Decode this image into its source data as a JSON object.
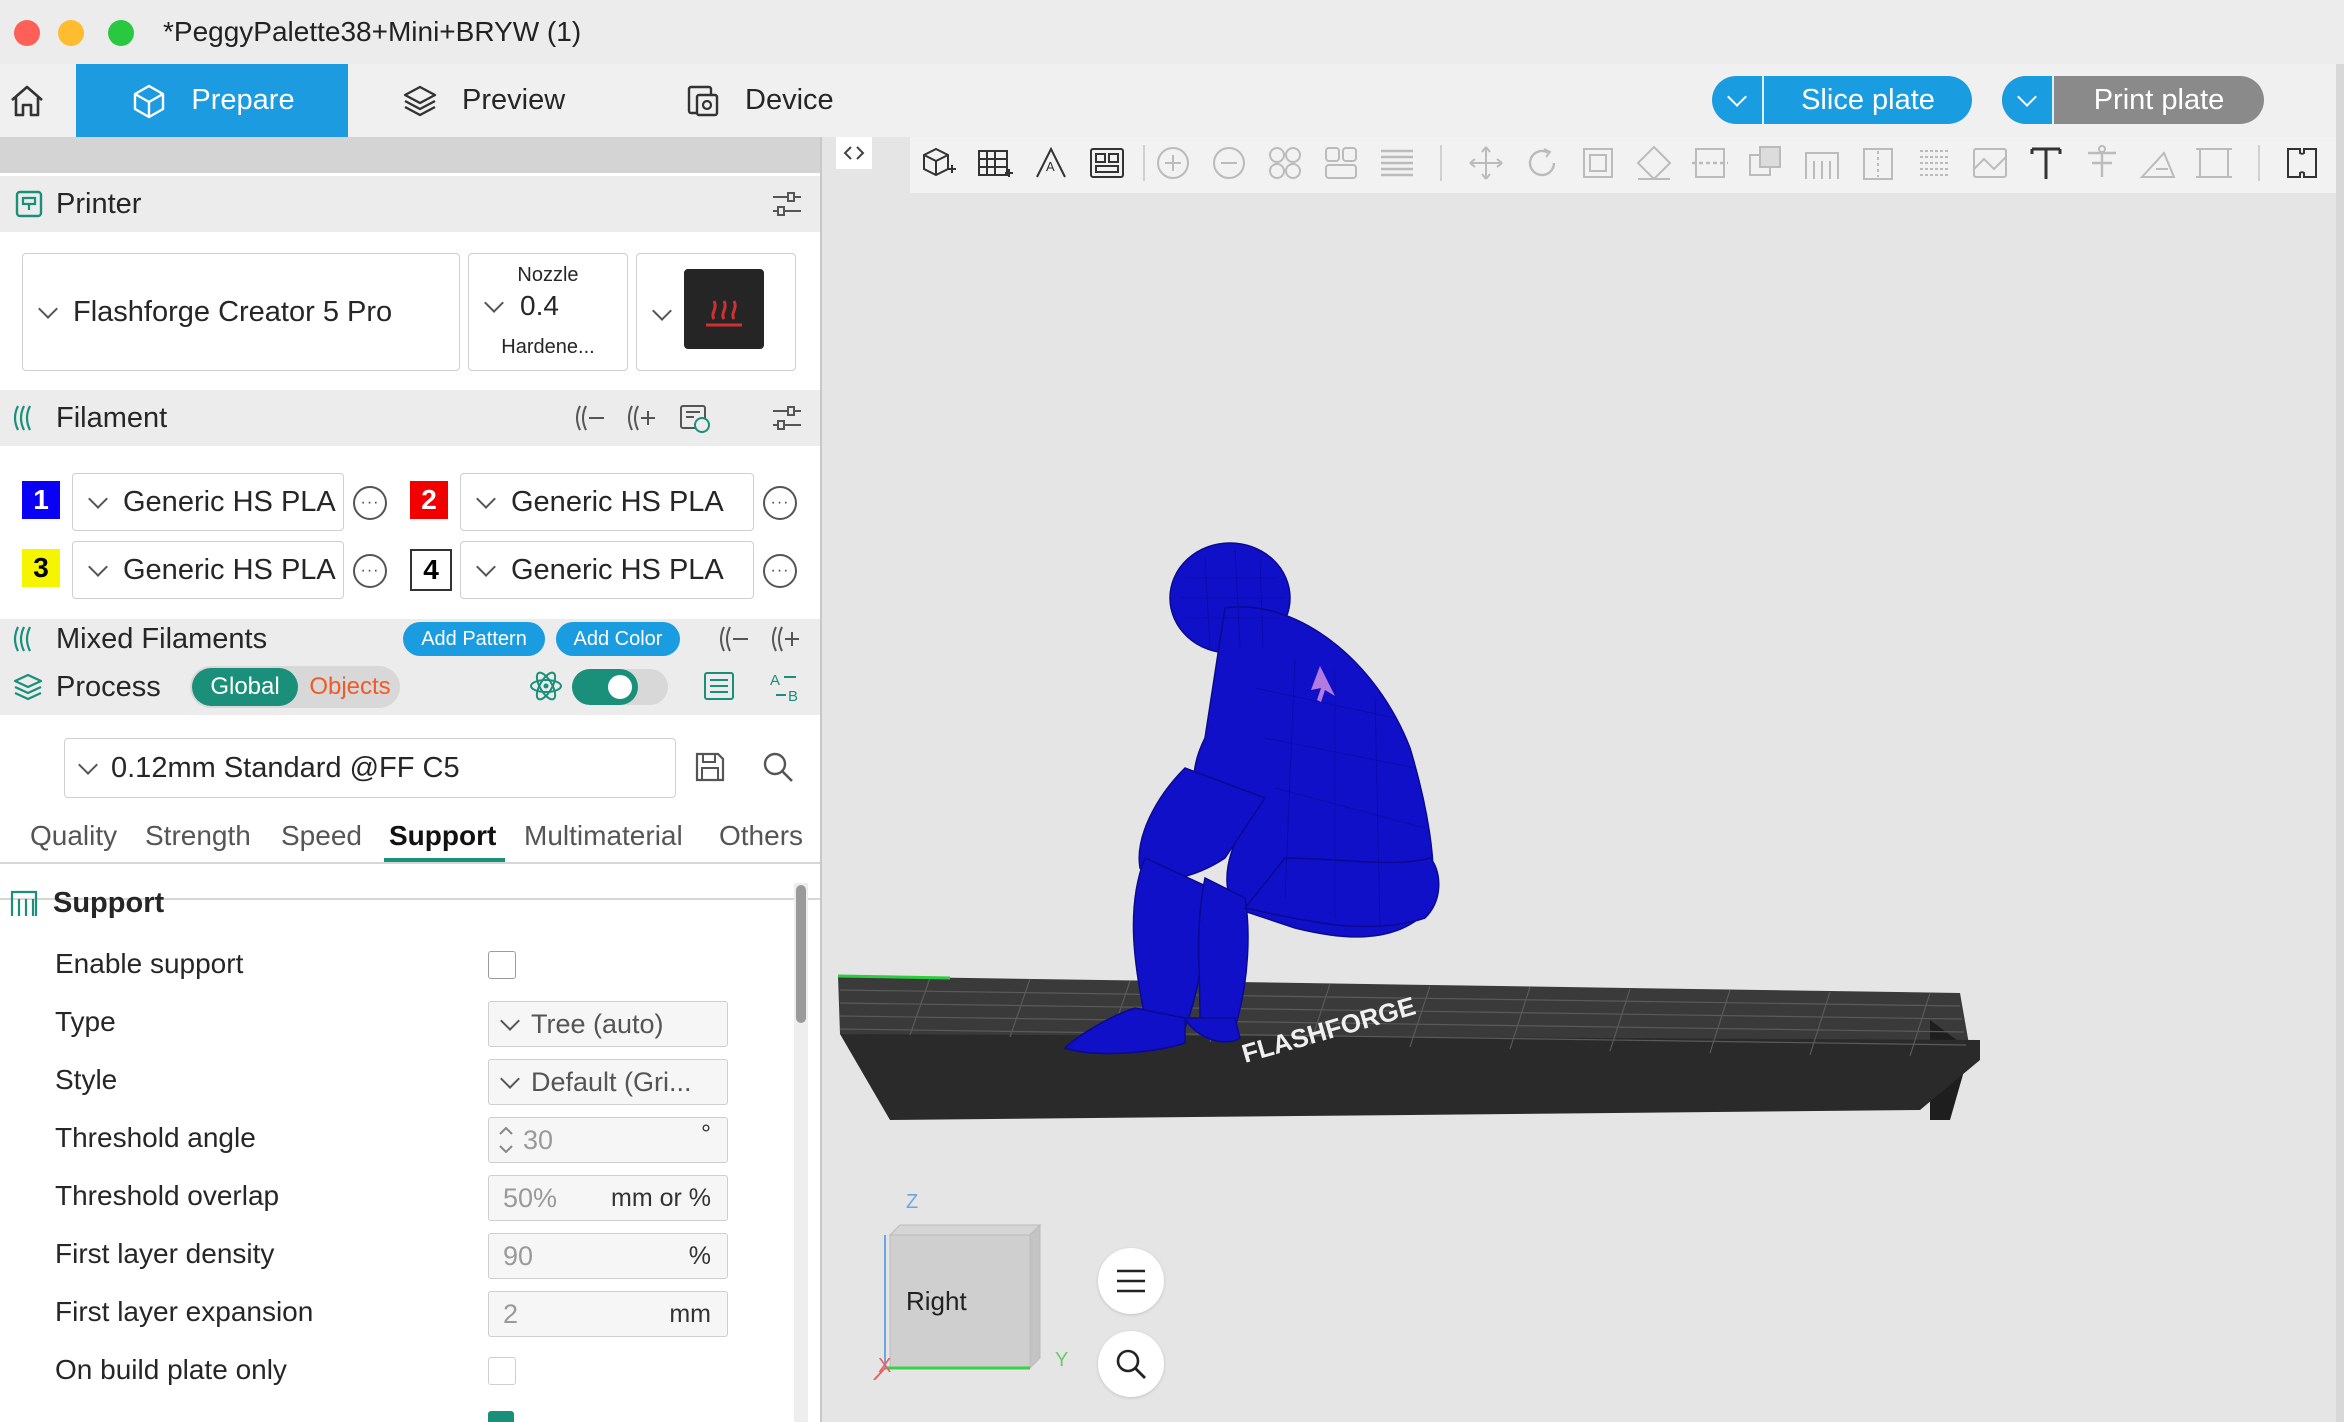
{
  "window": {
    "title": "*PeggyPalette38+Mini+BRYW (1)"
  },
  "nav": {
    "tabs": [
      {
        "label": "Prepare",
        "active": true
      },
      {
        "label": "Preview",
        "active": false
      },
      {
        "label": "Device",
        "active": false
      }
    ],
    "slice_label": "Slice plate",
    "print_label": "Print plate",
    "accent": "#1a9de0",
    "active_tab_color": "#1c9be0"
  },
  "printer": {
    "section_title": "Printer",
    "name": "Flashforge Creator 5 Pro",
    "nozzle_label": "Nozzle",
    "nozzle_value": "0.4",
    "nozzle_type": "Hardene..."
  },
  "filament": {
    "section_title": "Filament",
    "slots": [
      {
        "number": "1",
        "color": "#0a00f5",
        "text_color": "#ffffff",
        "name": "Generic HS PLA"
      },
      {
        "number": "2",
        "color": "#f20000",
        "text_color": "#ffffff",
        "name": "Generic HS PLA"
      },
      {
        "number": "3",
        "color": "#f5f500",
        "text_color": "#000000",
        "name": "Generic HS PLA"
      },
      {
        "number": "4",
        "color": "#ffffff",
        "text_color": "#000000",
        "name": "Generic HS PLA"
      }
    ],
    "mixed_title": "Mixed Filaments",
    "add_pattern": "Add Pattern",
    "add_color": "Add Color"
  },
  "process": {
    "section_title": "Process",
    "toggle_global": "Global",
    "toggle_objects": "Objects",
    "preset": "0.12mm Standard @FF C5",
    "tabs": [
      "Quality",
      "Strength",
      "Speed",
      "Support",
      "Multimaterial",
      "Others"
    ],
    "active_tab": "Support"
  },
  "support": {
    "group_title": "Support",
    "rows": {
      "enable": {
        "label": "Enable support",
        "checked": false
      },
      "type": {
        "label": "Type",
        "value": "Tree (auto)"
      },
      "style": {
        "label": "Style",
        "value": "Default (Gri..."
      },
      "threshold_angle": {
        "label": "Threshold angle",
        "value": "30",
        "unit": "°"
      },
      "threshold_overlap": {
        "label": "Threshold overlap",
        "value": "50%",
        "unit": "mm or %"
      },
      "first_layer_density": {
        "label": "First layer density",
        "value": "90",
        "unit": "%"
      },
      "first_layer_expansion": {
        "label": "First layer expansion",
        "value": "2",
        "unit": "mm"
      },
      "on_build_plate_only": {
        "label": "On build plate only",
        "checked": false
      }
    }
  },
  "viewport": {
    "view_cube_label": "Right",
    "axis_z": "Z",
    "axis_y": "Y",
    "axis_x": "X",
    "model_color": "#1010c8"
  }
}
